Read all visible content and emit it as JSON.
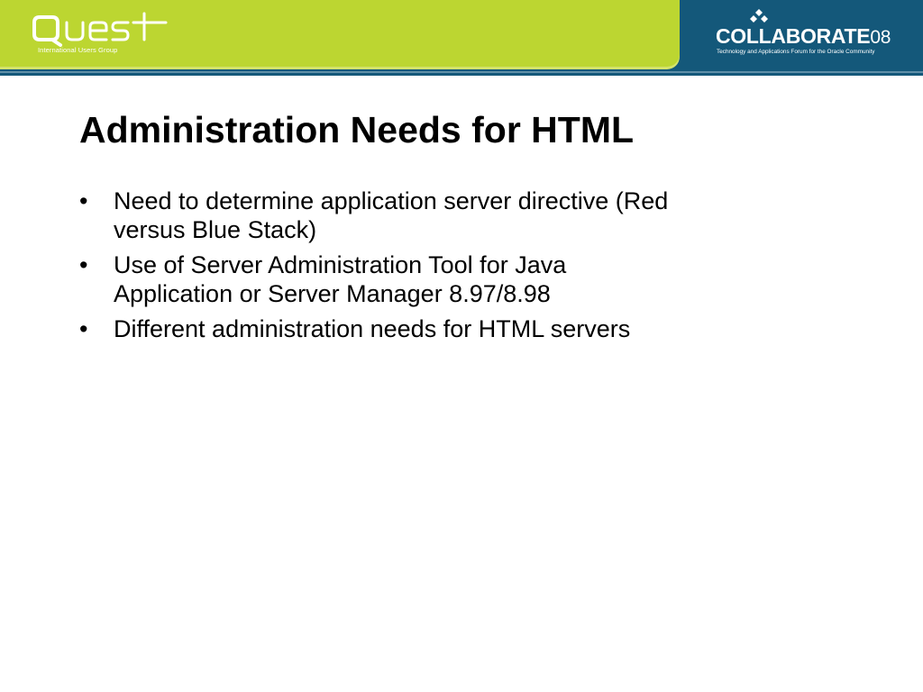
{
  "header": {
    "left_logo": {
      "name": "Quest",
      "tagline": "International Users Group"
    },
    "right_logo": {
      "name": "COLLABORATE",
      "year": "08",
      "tagline": "Technology and Applications Forum for the Oracle Community",
      "icon": "diamond-cluster-icon"
    },
    "colors": {
      "green": "#bcd631",
      "blue": "#14587a",
      "white": "#ffffff"
    }
  },
  "slide": {
    "title": "Administration Needs for HTML",
    "bullet_symbol": "•",
    "bullets": [
      {
        "text_line1": "Need to determine application server directive (Red",
        "text_line2": "versus Blue Stack)"
      },
      {
        "text_line1": "Use of Server Administration Tool for Java",
        "text_line2": "Application or Server Manager 8.97/8.98"
      },
      {
        "text_line1": "Different administration needs for HTML servers",
        "text_line2": ""
      }
    ]
  }
}
